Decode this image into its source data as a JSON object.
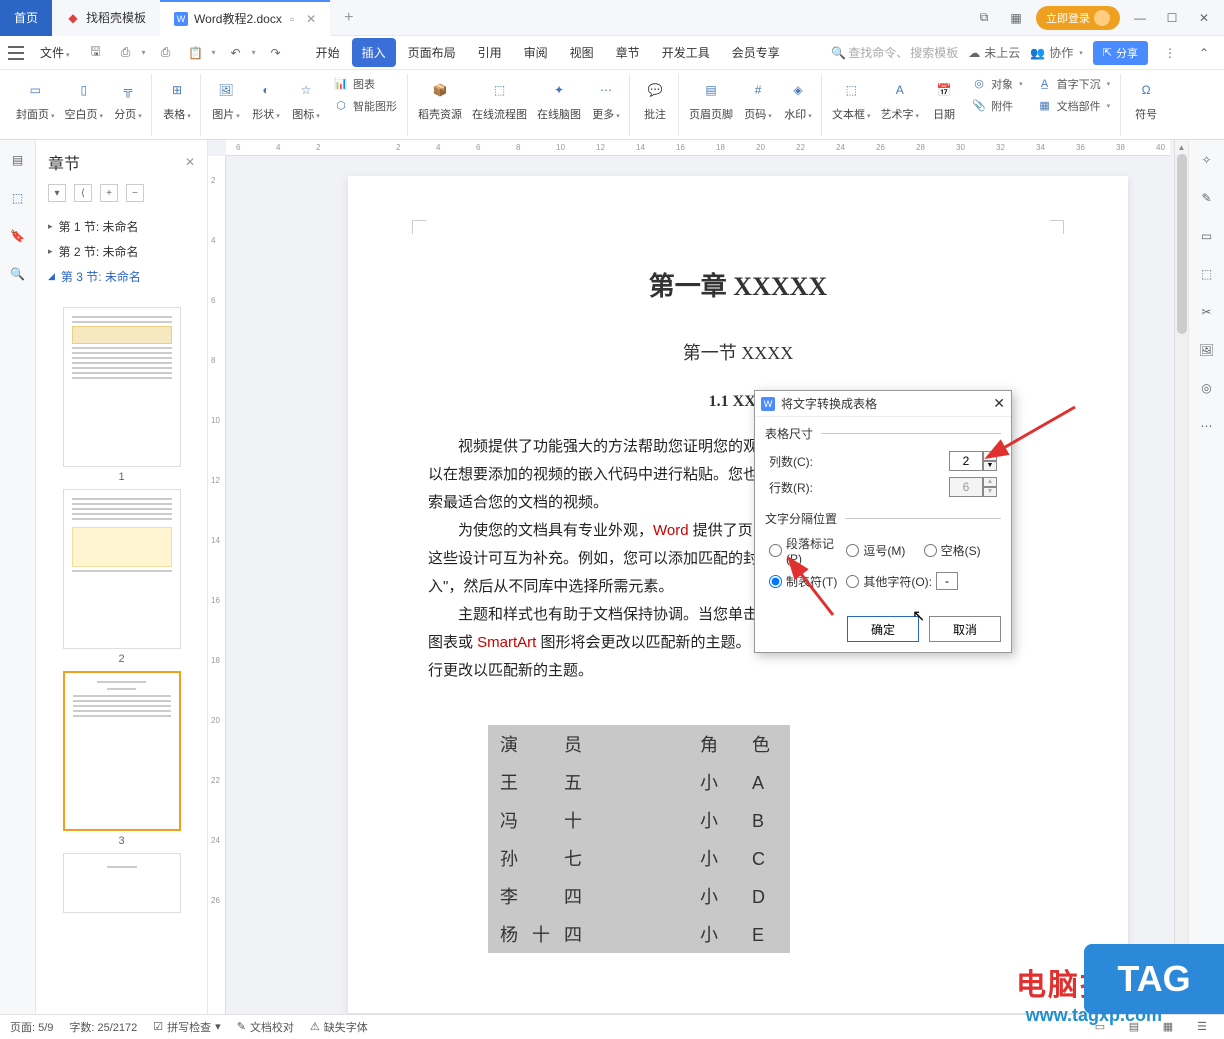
{
  "tabs": {
    "home": "首页",
    "template": "找稻壳模板",
    "doc": "Word教程2.docx"
  },
  "login": "立即登录",
  "menu": {
    "file": "文件",
    "items": [
      "开始",
      "插入",
      "页面布局",
      "引用",
      "审阅",
      "视图",
      "章节",
      "开发工具",
      "会员专享"
    ],
    "active": 1,
    "search_cmd": "查找命令、",
    "search_tpl": "搜索模板",
    "not_cloud": "未上云",
    "coop": "协作",
    "share": "分享"
  },
  "toolbar": {
    "cover": "封面页",
    "blank": "空白页",
    "break": "分页",
    "table": "表格",
    "pic": "图片",
    "shape": "形状",
    "icon": "图标",
    "chart": "图表",
    "smart": "智能图形",
    "res": "稻壳资源",
    "flow": "在线流程图",
    "mind": "在线脑图",
    "more": "更多",
    "comment": "批注",
    "header": "页眉页脚",
    "pagenum": "页码",
    "watermark": "水印",
    "textbox": "文本框",
    "wordart": "艺术字",
    "date": "日期",
    "object": "对象",
    "attach": "附件",
    "dropcap": "首字下沉",
    "parts": "文档部件",
    "symbol": "符号"
  },
  "sidebar": {
    "title": "章节",
    "sections": [
      {
        "label": "第 1 节: 未命名"
      },
      {
        "label": "第 2 节: 未命名"
      },
      {
        "label": "第 3 节: 未命名"
      }
    ],
    "thumbs": [
      "1",
      "2",
      "3"
    ]
  },
  "doc": {
    "h1": "第一章  XXXXX",
    "h2": "第一节  XXXX",
    "h3": "1.1 XXX",
    "p1a": "视频提供了功能强大的方法帮助您证明您的观",
    "p1b": "以在想要添加的视频的嵌入代码中进行粘贴。您也",
    "p1c": "索最适合您的文档的视频。",
    "p2a": "为使您的文档具有专业外观，",
    "p2w": "Word",
    "p2b": " 提供了页",
    "p2c": "这些设计可互为补充。例如，您可以添加匹配的封",
    "p2d": "入\"，然后从不同库中选择所需元素。",
    "p3a": "主题和样式也有助于文档保持协调。当您单击",
    "p3b": "图表或 ",
    "p3s": "SmartArt",
    "p3c": " 图形将会更改以匹配新的主题。",
    "p3d": "行更改以匹配新的主题。",
    "table": [
      [
        "演　员",
        "角　色"
      ],
      [
        "王　五",
        "小　A"
      ],
      [
        "冯　十",
        "小　B"
      ],
      [
        "孙　七",
        "小　C"
      ],
      [
        "李　四",
        "小　D"
      ],
      [
        "杨十四",
        "小　E"
      ]
    ]
  },
  "dialog": {
    "title": "将文字转换成表格",
    "size_legend": "表格尺寸",
    "cols_label": "列数(C):",
    "cols_value": "2",
    "rows_label": "行数(R):",
    "rows_value": "6",
    "sep_legend": "文字分隔位置",
    "r_para": "段落标记(P)",
    "r_comma": "逗号(M)",
    "r_space": "空格(S)",
    "r_tab": "制表符(T)",
    "r_other": "其他字符(O):",
    "other_value": "-",
    "ok": "确定",
    "cancel": "取消"
  },
  "status": {
    "page": "页面: 5/9",
    "words": "字数: 25/2172",
    "spell": "拼写检查",
    "proof": "文档校对",
    "font": "缺失字体"
  },
  "ruler_h": [
    "6",
    "4",
    "2",
    "",
    "2",
    "4",
    "6",
    "8",
    "10",
    "12",
    "14",
    "16",
    "18",
    "20",
    "22",
    "24",
    "26",
    "28",
    "30",
    "32",
    "34",
    "36",
    "38",
    "40"
  ],
  "ruler_v": [
    "2",
    "4",
    "6",
    "8",
    "10",
    "12",
    "14",
    "16",
    "18",
    "20",
    "22",
    "24",
    "26"
  ],
  "wm": {
    "brand": "电脑技术网",
    "url": "www.tagxp.com",
    "tag": "TAG"
  }
}
